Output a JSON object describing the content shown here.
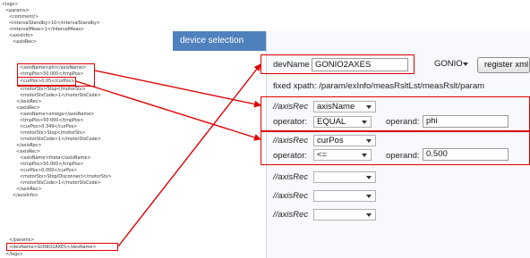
{
  "xml": {
    "lines": [
      "<logs>",
      "<params>",
      "<comment/>",
      "<intervalStandby>10</intervalStandby>",
      "<intervalMeas>1</intervalMeas>",
      "<axisInfo>",
      "<axisRec>",
      "<axisName>phi</axisName>",
      "<tmpPos>50.000</tmpPos>",
      "<curPos>0.05</curPos>",
      "<motorSts>Stop</motorSts>",
      "<motorStsCode>1</motorStsCode>",
      "</axisRec>",
      "<axisRec>",
      "<axisName>omega</axisName>",
      "<tmpPos>50.000</tmpPos>",
      "<curPos>0.349</curPos>",
      "<motorSts>Stop</motorSts>",
      "<motorStsCode>1</motorStsCode>",
      "</axisRec>",
      "<axisRec>",
      "<axisName>theta</axisName>",
      "<tmpPos>50.000</tmpPos>",
      "<curPos>0.000</curPos>",
      "<motorSts>Stop/Disconnect</motorSts>",
      "<motorStsCode>1</motorStsCode>",
      "</axisRec>",
      "</axisInfo>",
      "</params>",
      "<devName>GONIO2AXES</devName>",
      "</logs>"
    ]
  },
  "panel": {
    "title": "device selection",
    "dev_name_label": "devName",
    "dev_name_value": "GONIO2AXES",
    "dev_type_select": "GONIO",
    "register_button": "register xml",
    "xpath_text": "fixed xpath: /param/exInfo/measRsltLst/measRslt/param"
  },
  "conditions": [
    {
      "axis_label": "//axisRec",
      "axis_value": "axisName",
      "operator_label": "operator:",
      "operator_value": "EQUAL",
      "operand_label": "operand:",
      "operand_value": "phi"
    },
    {
      "axis_label": "//axisRec",
      "axis_value": "curPos",
      "operator_label": "operator:",
      "operator_value": "<=",
      "operand_label": "operand:",
      "operand_value": "0.500"
    },
    {
      "axis_label": "//axisRec",
      "axis_value": ""
    },
    {
      "axis_label": "//axisRec",
      "axis_value": ""
    },
    {
      "axis_label": "//axisRec",
      "axis_value": ""
    }
  ],
  "colors": {
    "header_blue": "#4f81bd",
    "highlight_red": "#e00000"
  }
}
